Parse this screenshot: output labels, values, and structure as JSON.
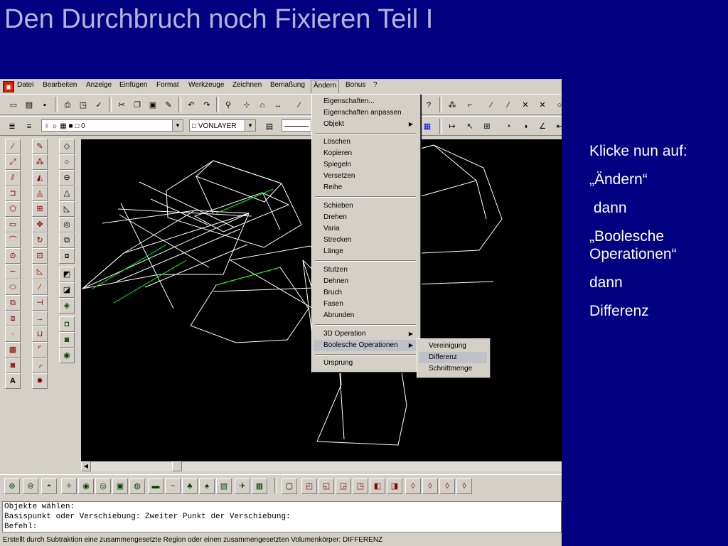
{
  "slide": {
    "title": "Den Durchbruch noch Fixieren Teil I",
    "instructions": [
      "Klicke nun auf:",
      "„Ändern“",
      " dann",
      "„Boolesche Operationen“",
      "dann",
      "Differenz"
    ]
  },
  "menubar": {
    "items": [
      "Datei",
      "Bearbeiten",
      "Anzeige",
      "Einfügen",
      "Format",
      "Werkzeuge",
      "Zeichnen",
      "Bemaßung",
      "Ändern",
      "Bonus",
      "?"
    ]
  },
  "layer_toolbar": {
    "layer_value": "0",
    "linetype_value": "VONLAYER"
  },
  "dropdown_menu": {
    "items": [
      {
        "label": "Eigenschaften...",
        "type": "item"
      },
      {
        "label": "Eigenschaften anpassen",
        "type": "item"
      },
      {
        "label": "Objekt",
        "type": "submenu"
      },
      {
        "type": "separator"
      },
      {
        "label": "Löschen",
        "type": "item"
      },
      {
        "label": "Kopieren",
        "type": "item"
      },
      {
        "label": "Spiegeln",
        "type": "item"
      },
      {
        "label": "Versetzen",
        "type": "item"
      },
      {
        "label": "Reihe",
        "type": "item"
      },
      {
        "type": "separator"
      },
      {
        "label": "Schieben",
        "type": "item"
      },
      {
        "label": "Drehen",
        "type": "item"
      },
      {
        "label": "Varia",
        "type": "item"
      },
      {
        "label": "Strecken",
        "type": "item"
      },
      {
        "label": "Länge",
        "type": "item"
      },
      {
        "type": "separator"
      },
      {
        "label": "Stutzen",
        "type": "item"
      },
      {
        "label": "Dehnen",
        "type": "item"
      },
      {
        "label": "Bruch",
        "type": "item"
      },
      {
        "label": "Fasen",
        "type": "item"
      },
      {
        "label": "Abrunden",
        "type": "item"
      },
      {
        "type": "separator"
      },
      {
        "label": "3D Operation",
        "type": "submenu"
      },
      {
        "label": "Boolesche Operationen",
        "type": "submenu",
        "highlighted": true
      },
      {
        "type": "separator"
      },
      {
        "label": "Ursprung",
        "type": "item"
      }
    ]
  },
  "submenu": {
    "items": [
      {
        "label": "Vereinigung",
        "highlighted": false
      },
      {
        "label": "Differenz",
        "highlighted": true
      },
      {
        "label": "Schnittmenge",
        "highlighted": false
      }
    ]
  },
  "command_window": {
    "lines": [
      "Objekte wählen:",
      "Basispunkt oder Verschiebung: Zweiter Punkt der Verschiebung:",
      "Befehl:"
    ]
  },
  "statusbar": {
    "text": "Erstellt durch Subtraktion eine zusammengesetzte Region oder einen zusammengesetzten Volumenkörper:  DIFFERENZ"
  },
  "colors": {
    "slide_background": "#000080",
    "title": "#b4b4dc",
    "drawing_background": "#000000",
    "drawing_lines": "#ffffff",
    "drawing_accent": "#00ff00",
    "ui_gray": "#d4d0c8"
  }
}
